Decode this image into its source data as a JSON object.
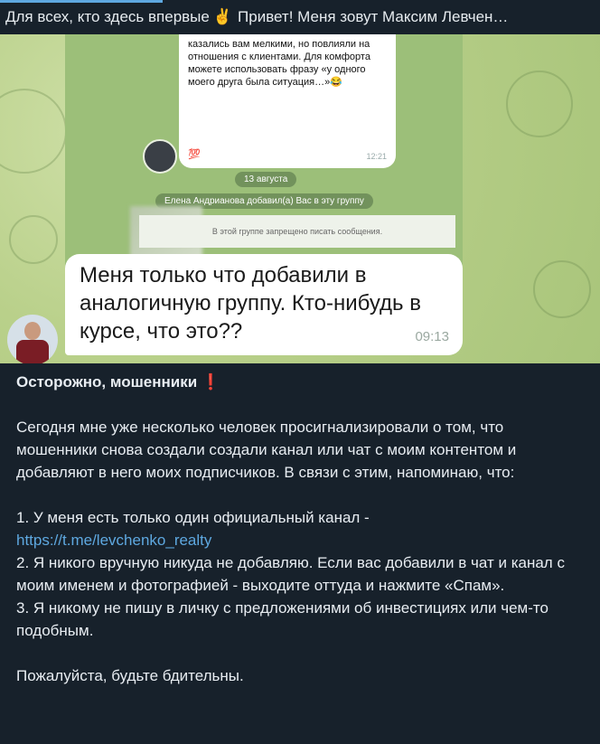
{
  "pinned": {
    "text": "Для всех, кто здесь впервые",
    "emoji": "✌",
    "greeting": "Привет! Меня зовут Максим Левчен…"
  },
  "screenshot": {
    "message_text": "казались вам мелкими, но повлияли на отношения с клиентами. Для комфорта можете использовать фразу «у одного моего друга была ситуация…»😂",
    "message_time": "12:21",
    "reaction": "💯",
    "date_label": "13 августа",
    "service_message": "Елена Андрианова добавил(а) Вас в эту группу",
    "restriction": "В этой группе запрещено писать сообщения."
  },
  "message": {
    "text": "Меня только что добавили в аналогичную группу. Кто-нибудь в курсе, что это??",
    "time": "09:13"
  },
  "post": {
    "title": "Осторожно, мошенники",
    "title_mark": "❗",
    "intro": "Сегодня мне уже несколько человек просигнализировали о том, что мошенники снова создали создали канал или чат с моим контентом и добавляют в него моих подписчиков. В связи с этим, напоминаю, что:",
    "item1_text": "1. У меня есть только один официальный канал -",
    "item1_link": "https://t.me/levchenko_realty",
    "item2": "2. Я никого вручную никуда не добавляю. Если вас добавили в чат и канал с моим именем и фотографией - выходите оттуда и нажмите «Спам».",
    "item3": "3. Я никому не пишу в личку с предложениями об инвестициях или чем-то подобным.",
    "closing": "Пожалуйста, будьте бдительны."
  },
  "colors": {
    "background": "#17212b",
    "link": "#5ea8e0",
    "alert": "#e3262f"
  }
}
